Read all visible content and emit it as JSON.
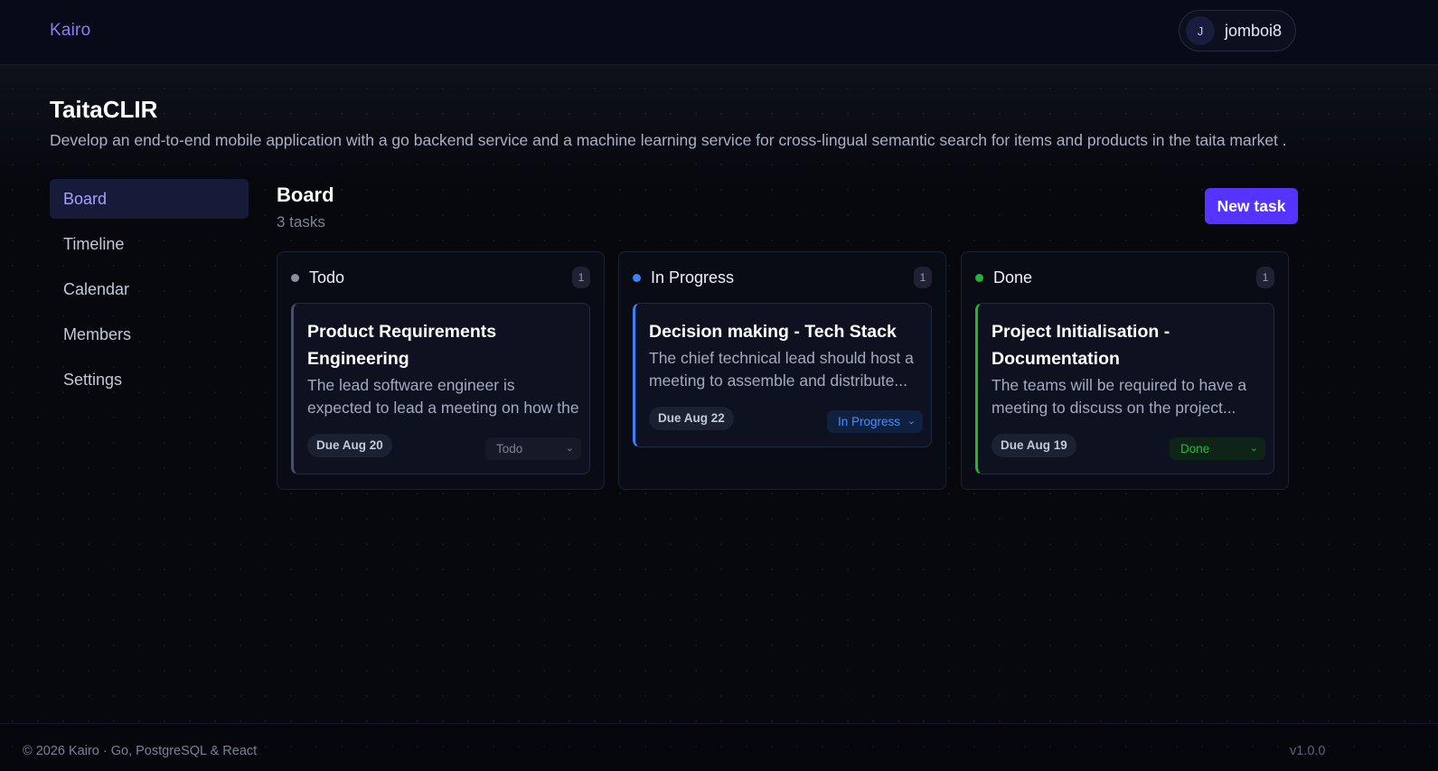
{
  "app": {
    "brand": "Kairo"
  },
  "user": {
    "avatar_initial": "J",
    "username": "jomboi8"
  },
  "project": {
    "title": "TaitaCLIR",
    "description": "Develop an end-to-end mobile application with a go backend service and a machine learning service for cross-lingual semantic search for items and products in the taita market ."
  },
  "sidebar": {
    "items": [
      {
        "label": "Board",
        "active": true
      },
      {
        "label": "Timeline",
        "active": false
      },
      {
        "label": "Calendar",
        "active": false
      },
      {
        "label": "Members",
        "active": false
      },
      {
        "label": "Settings",
        "active": false
      }
    ]
  },
  "board": {
    "title": "Board",
    "count": "3 tasks",
    "new_task_label": "New task",
    "columns": [
      {
        "title": "Todo",
        "count": "1",
        "dot_color": "#8a8f9e",
        "accent": "#4a5068",
        "cards": [
          {
            "title": "Product Requirements Engineering",
            "description": "The lead software engineer is expected to lead a meeting on how the softwa...",
            "due": "Due Aug 20",
            "status": "Todo"
          }
        ]
      },
      {
        "title": "In Progress",
        "count": "1",
        "dot_color": "#3b82f6",
        "accent": "#3b82f6",
        "cards": [
          {
            "title": "Decision making - Tech Stack",
            "description": "The chief technical lead should host a meeting to assemble and distribute...",
            "due": "Due Aug 22",
            "status": "In Progress"
          }
        ]
      },
      {
        "title": "Done",
        "count": "1",
        "dot_color": "#22b534",
        "accent": "#22b534",
        "cards": [
          {
            "title": "Project Initialisation - Documentation",
            "description": "The teams will be required to have a meeting to discuss on the project...",
            "due": "Due Aug 19",
            "status": "Done"
          }
        ]
      }
    ]
  },
  "footer": {
    "left": "© 2026 Kairo · Go, PostgreSQL & React",
    "right": "v1.0.0"
  }
}
